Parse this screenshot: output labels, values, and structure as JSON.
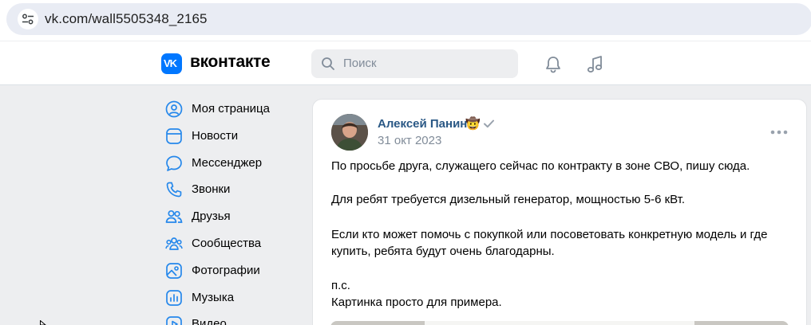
{
  "browser": {
    "url": "vk.com/wall5505348_2165",
    "site_info_icon": "tune-icon"
  },
  "header": {
    "logo_mark": "VK",
    "brand": "вконтакте",
    "search_placeholder": "Поиск",
    "icons": [
      "search-icon",
      "bell-icon",
      "music-note-icon"
    ]
  },
  "nav": {
    "items": [
      {
        "label": "Моя страница",
        "icon": "profile-icon"
      },
      {
        "label": "Новости",
        "icon": "news-icon"
      },
      {
        "label": "Мессенджер",
        "icon": "messenger-icon"
      },
      {
        "label": "Звонки",
        "icon": "phone-icon"
      },
      {
        "label": "Друзья",
        "icon": "friends-icon"
      },
      {
        "label": "Сообщества",
        "icon": "communities-icon"
      },
      {
        "label": "Фотографии",
        "icon": "photos-icon"
      },
      {
        "label": "Музыка",
        "icon": "music-icon"
      },
      {
        "label": "Видео",
        "icon": "video-icon"
      }
    ]
  },
  "post": {
    "author": "Алексей Панин",
    "author_emoji": "🤠",
    "date": "31 окт 2023",
    "paragraphs": [
      "По просьбе друга, служащего сейчас по контракту в зоне СВО, пишу сюда.",
      "Для ребят требуется дизельный генератор, мощностью 5-6 кВт.",
      "Если кто может помочь с покупкой или посоветовать конкретную модель и где",
      "купить, ребята будут очень благодарны.",
      "п.с.",
      "Картинка просто для примера."
    ]
  },
  "colors": {
    "accent": "#0077ff",
    "link": "#2a5885",
    "page_bg": "#edeef0",
    "secondary_text": "#818c99",
    "icon": "#2688eb"
  }
}
